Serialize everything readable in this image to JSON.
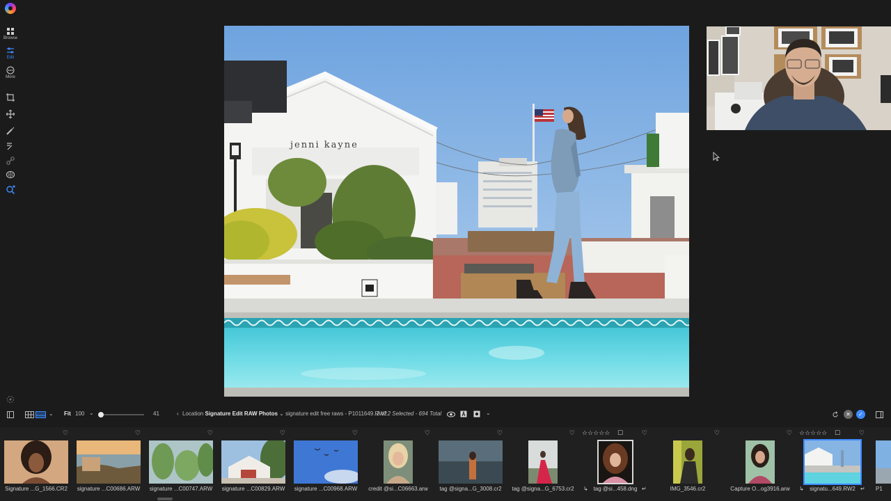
{
  "rail": {
    "modes": [
      {
        "label": "Browse",
        "icon": "grid-icon"
      },
      {
        "label": "Edit",
        "icon": "sliders-icon"
      },
      {
        "label": "More",
        "icon": "more-icon"
      }
    ]
  },
  "viewer": {
    "storefront_sign": "jenni kayne"
  },
  "toolbar": {
    "zoom_mode": "Fit",
    "zoom_value": "100",
    "thumb_size": "41",
    "thumb_size_fraction": 0.0,
    "location_label": "Location",
    "folder": "Signature Edit RAW Photos",
    "file_path": "signature edit free raws - P1011649.RW2",
    "selection_info": "2 of 2 Selected - 694 Total"
  },
  "colors": {
    "accent": "#3d8bff",
    "background": "#1b1b1b",
    "strip_bg": "#202020"
  },
  "filmstrip": [
    {
      "name": "Signature ...G_1566.CR2",
      "stars": false
    },
    {
      "name": "signature ...C00686.ARW",
      "stars": false
    },
    {
      "name": "signature ...C00747.ARW",
      "stars": false
    },
    {
      "name": "signature ...C00829.ARW",
      "stars": false
    },
    {
      "name": "signature ...C00968.ARW",
      "stars": false
    },
    {
      "name": "credit @si...C06663.arw",
      "stars": false
    },
    {
      "name": "tag @signa...G_3008.cr2",
      "stars": false
    },
    {
      "name": "tag @signa...G_6753.cr2",
      "stars": false
    },
    {
      "name": "tag @si...458.dng",
      "stars": true,
      "star_text": "☆☆☆☆☆"
    },
    {
      "name": "IMG_3546.cr2",
      "stars": false
    },
    {
      "name": "Capture O...og3916.arw",
      "stars": false
    },
    {
      "name": "signatu...649.RW2",
      "stars": true,
      "star_text": "☆☆☆☆☆"
    },
    {
      "name": "P1",
      "stars": false
    }
  ]
}
